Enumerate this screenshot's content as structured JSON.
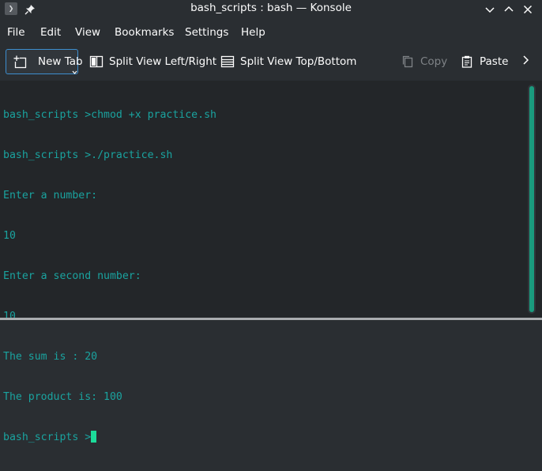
{
  "window": {
    "title": "bash_scripts : bash — Konsole",
    "app_icon_glyph": "❯"
  },
  "menu": {
    "items": [
      "File",
      "Edit",
      "View",
      "Bookmarks",
      "Settings",
      "Help"
    ]
  },
  "toolbar": {
    "new_tab": "New Tab",
    "split_left_right": "Split View Left/Right",
    "split_top_bottom": "Split View Top/Bottom",
    "copy": "Copy",
    "paste": "Paste"
  },
  "terminal": {
    "lines": [
      "bash_scripts >chmod +x practice.sh",
      "bash_scripts >./practice.sh",
      "Enter a number:",
      "10",
      "Enter a second number:",
      "10",
      "The sum is : 20",
      "The product is: 100",
      "bash_scripts >"
    ]
  },
  "colors": {
    "terminal_text": "#1aa39f",
    "terminal_bg": "#232629",
    "chrome_bg": "#2a2e32",
    "focus_border": "#3d8ecf",
    "cursor": "#1cdc9a"
  }
}
